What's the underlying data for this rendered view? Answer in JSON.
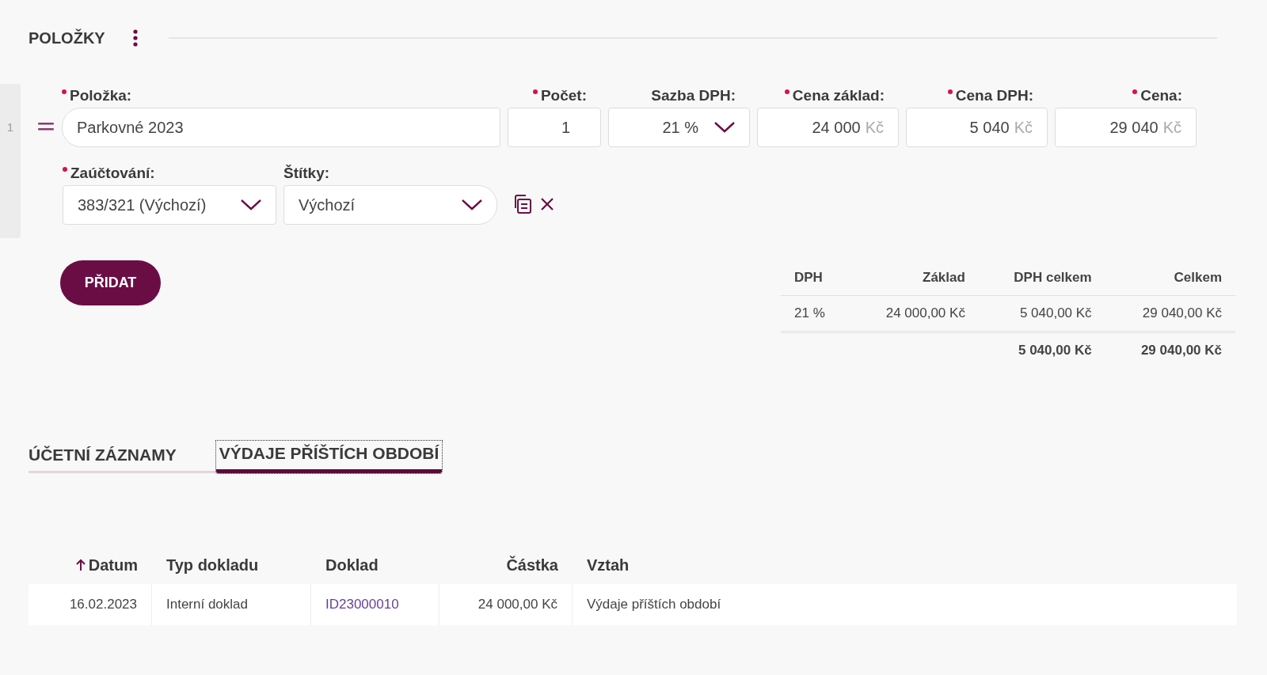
{
  "section": {
    "title": "POLOŽKY"
  },
  "line": {
    "number": "1",
    "fields": [
      {
        "label": "Položka:",
        "required": true,
        "kind": "text",
        "value": "Parkovné 2023"
      },
      {
        "label": "Počet:",
        "required": true,
        "kind": "number",
        "value": "1"
      },
      {
        "label": "Sazba DPH:",
        "required": false,
        "kind": "select",
        "value": "21 %"
      },
      {
        "label": "Cena základ:",
        "required": true,
        "kind": "money",
        "value": "24 000",
        "unit": "Kč"
      },
      {
        "label": "Cena DPH:",
        "required": true,
        "kind": "money",
        "value": "5 040",
        "unit": "Kč"
      },
      {
        "label": "Cena:",
        "required": true,
        "kind": "money",
        "value": "29 040",
        "unit": "Kč"
      }
    ],
    "fields2": [
      {
        "label": "Zaúčtování:",
        "required": true,
        "kind": "select",
        "value": "383/321 (Výchozí)"
      },
      {
        "label": "Štítky:",
        "required": false,
        "kind": "select",
        "value": "Výchozí"
      }
    ]
  },
  "add_button": "PŘIDAT",
  "summary": {
    "columns": [
      "DPH",
      "Základ",
      "DPH celkem",
      "Celkem"
    ],
    "rows": [
      [
        "21 %",
        "24 000,00 Kč",
        "5 040,00 Kč",
        "29 040,00 Kč"
      ]
    ],
    "totals": [
      "5 040,00 Kč",
      "29 040,00 Kč"
    ]
  },
  "tabs": [
    {
      "label": "ÚČETNÍ ZÁZNAMY",
      "selected": false
    },
    {
      "label": "VÝDAJE PŘÍŠTÍCH OBDOBÍ",
      "selected": true
    }
  ],
  "table": {
    "columns": [
      {
        "label": "Datum",
        "sorted": true
      },
      {
        "label": "Typ dokladu",
        "sorted": false
      },
      {
        "label": "Doklad",
        "sorted": false
      },
      {
        "label": "Částka",
        "sorted": false
      },
      {
        "label": "Vztah",
        "sorted": false
      }
    ],
    "rows": [
      [
        "16.02.2023",
        "Interní doklad",
        "ID23000010",
        "24 000,00 Kč",
        "Výdaje příštích období"
      ]
    ]
  }
}
